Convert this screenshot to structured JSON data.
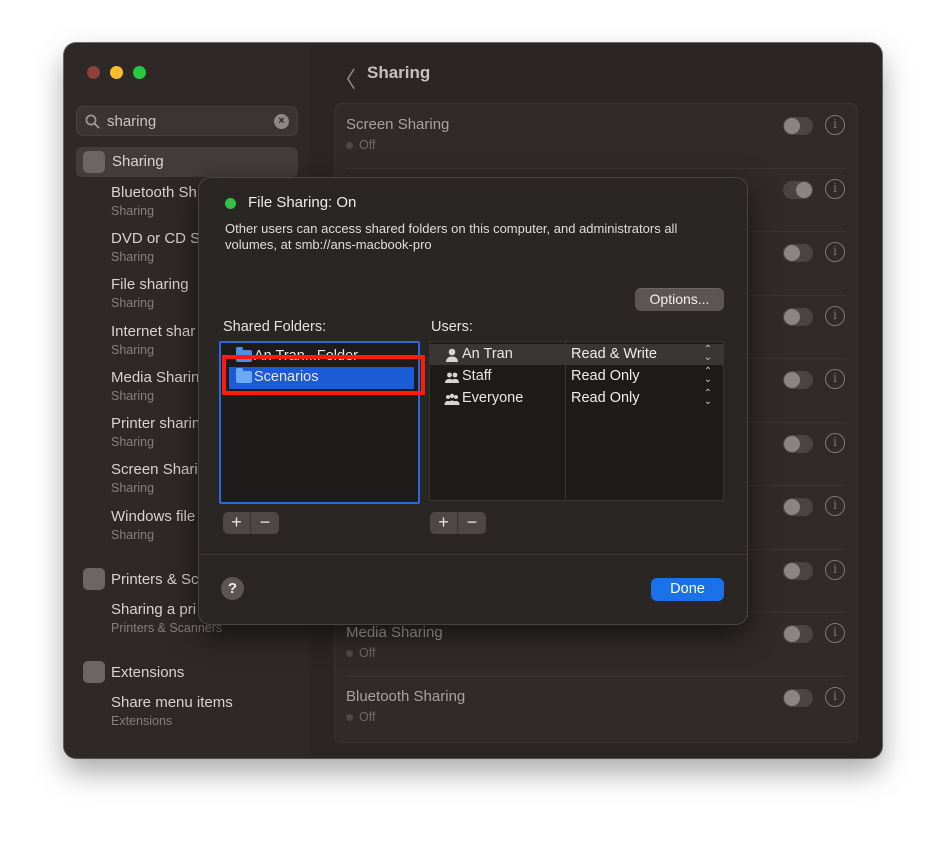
{
  "sidebar": {
    "search": {
      "value": "sharing"
    },
    "items": [
      {
        "title": "Sharing",
        "selected": true
      },
      {
        "title": "Bluetooth Sh",
        "subtitle": "Sharing"
      },
      {
        "title": "DVD or CD S",
        "subtitle": "Sharing"
      },
      {
        "title": "File sharing",
        "subtitle": "Sharing"
      },
      {
        "title": "Internet shar",
        "subtitle": "Sharing"
      },
      {
        "title": "Media Sharin",
        "subtitle": "Sharing"
      },
      {
        "title": "Printer sharin",
        "subtitle": "Sharing"
      },
      {
        "title": "Screen Shari",
        "subtitle": "Sharing"
      },
      {
        "title": "Windows file",
        "subtitle": "Sharing"
      }
    ],
    "printers": {
      "title": "Printers & Sc",
      "item": {
        "title": "Sharing a pri",
        "subtitle": "Printers & Scanners"
      }
    },
    "extensions": {
      "title": "Extensions",
      "item": {
        "title": "Share menu items",
        "subtitle": "Extensions"
      }
    }
  },
  "main": {
    "title": "Sharing",
    "back_glyph": "〈",
    "rows": [
      {
        "title": "Screen Sharing",
        "status": "Off",
        "on": false
      },
      {
        "title": "",
        "status": "",
        "on": true
      },
      {
        "title": "",
        "status": "",
        "on": false
      },
      {
        "title": "",
        "status": "",
        "on": false
      },
      {
        "title": "",
        "status": "",
        "on": false
      },
      {
        "title": "",
        "status": "",
        "on": false
      },
      {
        "title": "",
        "status": "",
        "on": false
      },
      {
        "title": "",
        "status": "",
        "on": false
      },
      {
        "title": "Media Sharing",
        "status": "Off",
        "on": false
      },
      {
        "title": "Bluetooth Sharing",
        "status": "Off",
        "on": false
      }
    ],
    "info_glyph": "i"
  },
  "sheet": {
    "title": "File Sharing: On",
    "description": "Other users can access shared folders on this computer, and administrators all volumes, at smb://ans-macbook-pro",
    "options_label": "Options...",
    "shared_folders_label": "Shared Folders:",
    "users_label": "Users:",
    "folders": [
      {
        "name": "An Tran...Folder",
        "selected": false
      },
      {
        "name": "Scenarios",
        "selected": true
      }
    ],
    "users": [
      {
        "name": "An Tran",
        "permission": "Read & Write",
        "icon": "person-icon"
      },
      {
        "name": "Staff",
        "permission": "Read Only",
        "icon": "group-icon"
      },
      {
        "name": "Everyone",
        "permission": "Read Only",
        "icon": "everyone-icon"
      }
    ],
    "plus": "+",
    "minus": "−",
    "help": "?",
    "done_label": "Done",
    "stepper_up": "⌃",
    "stepper_down": "⌄"
  },
  "colors": {
    "accent": "#1a71e8",
    "highlight_box": "#ff1a0e",
    "status_on": "#30c244"
  }
}
